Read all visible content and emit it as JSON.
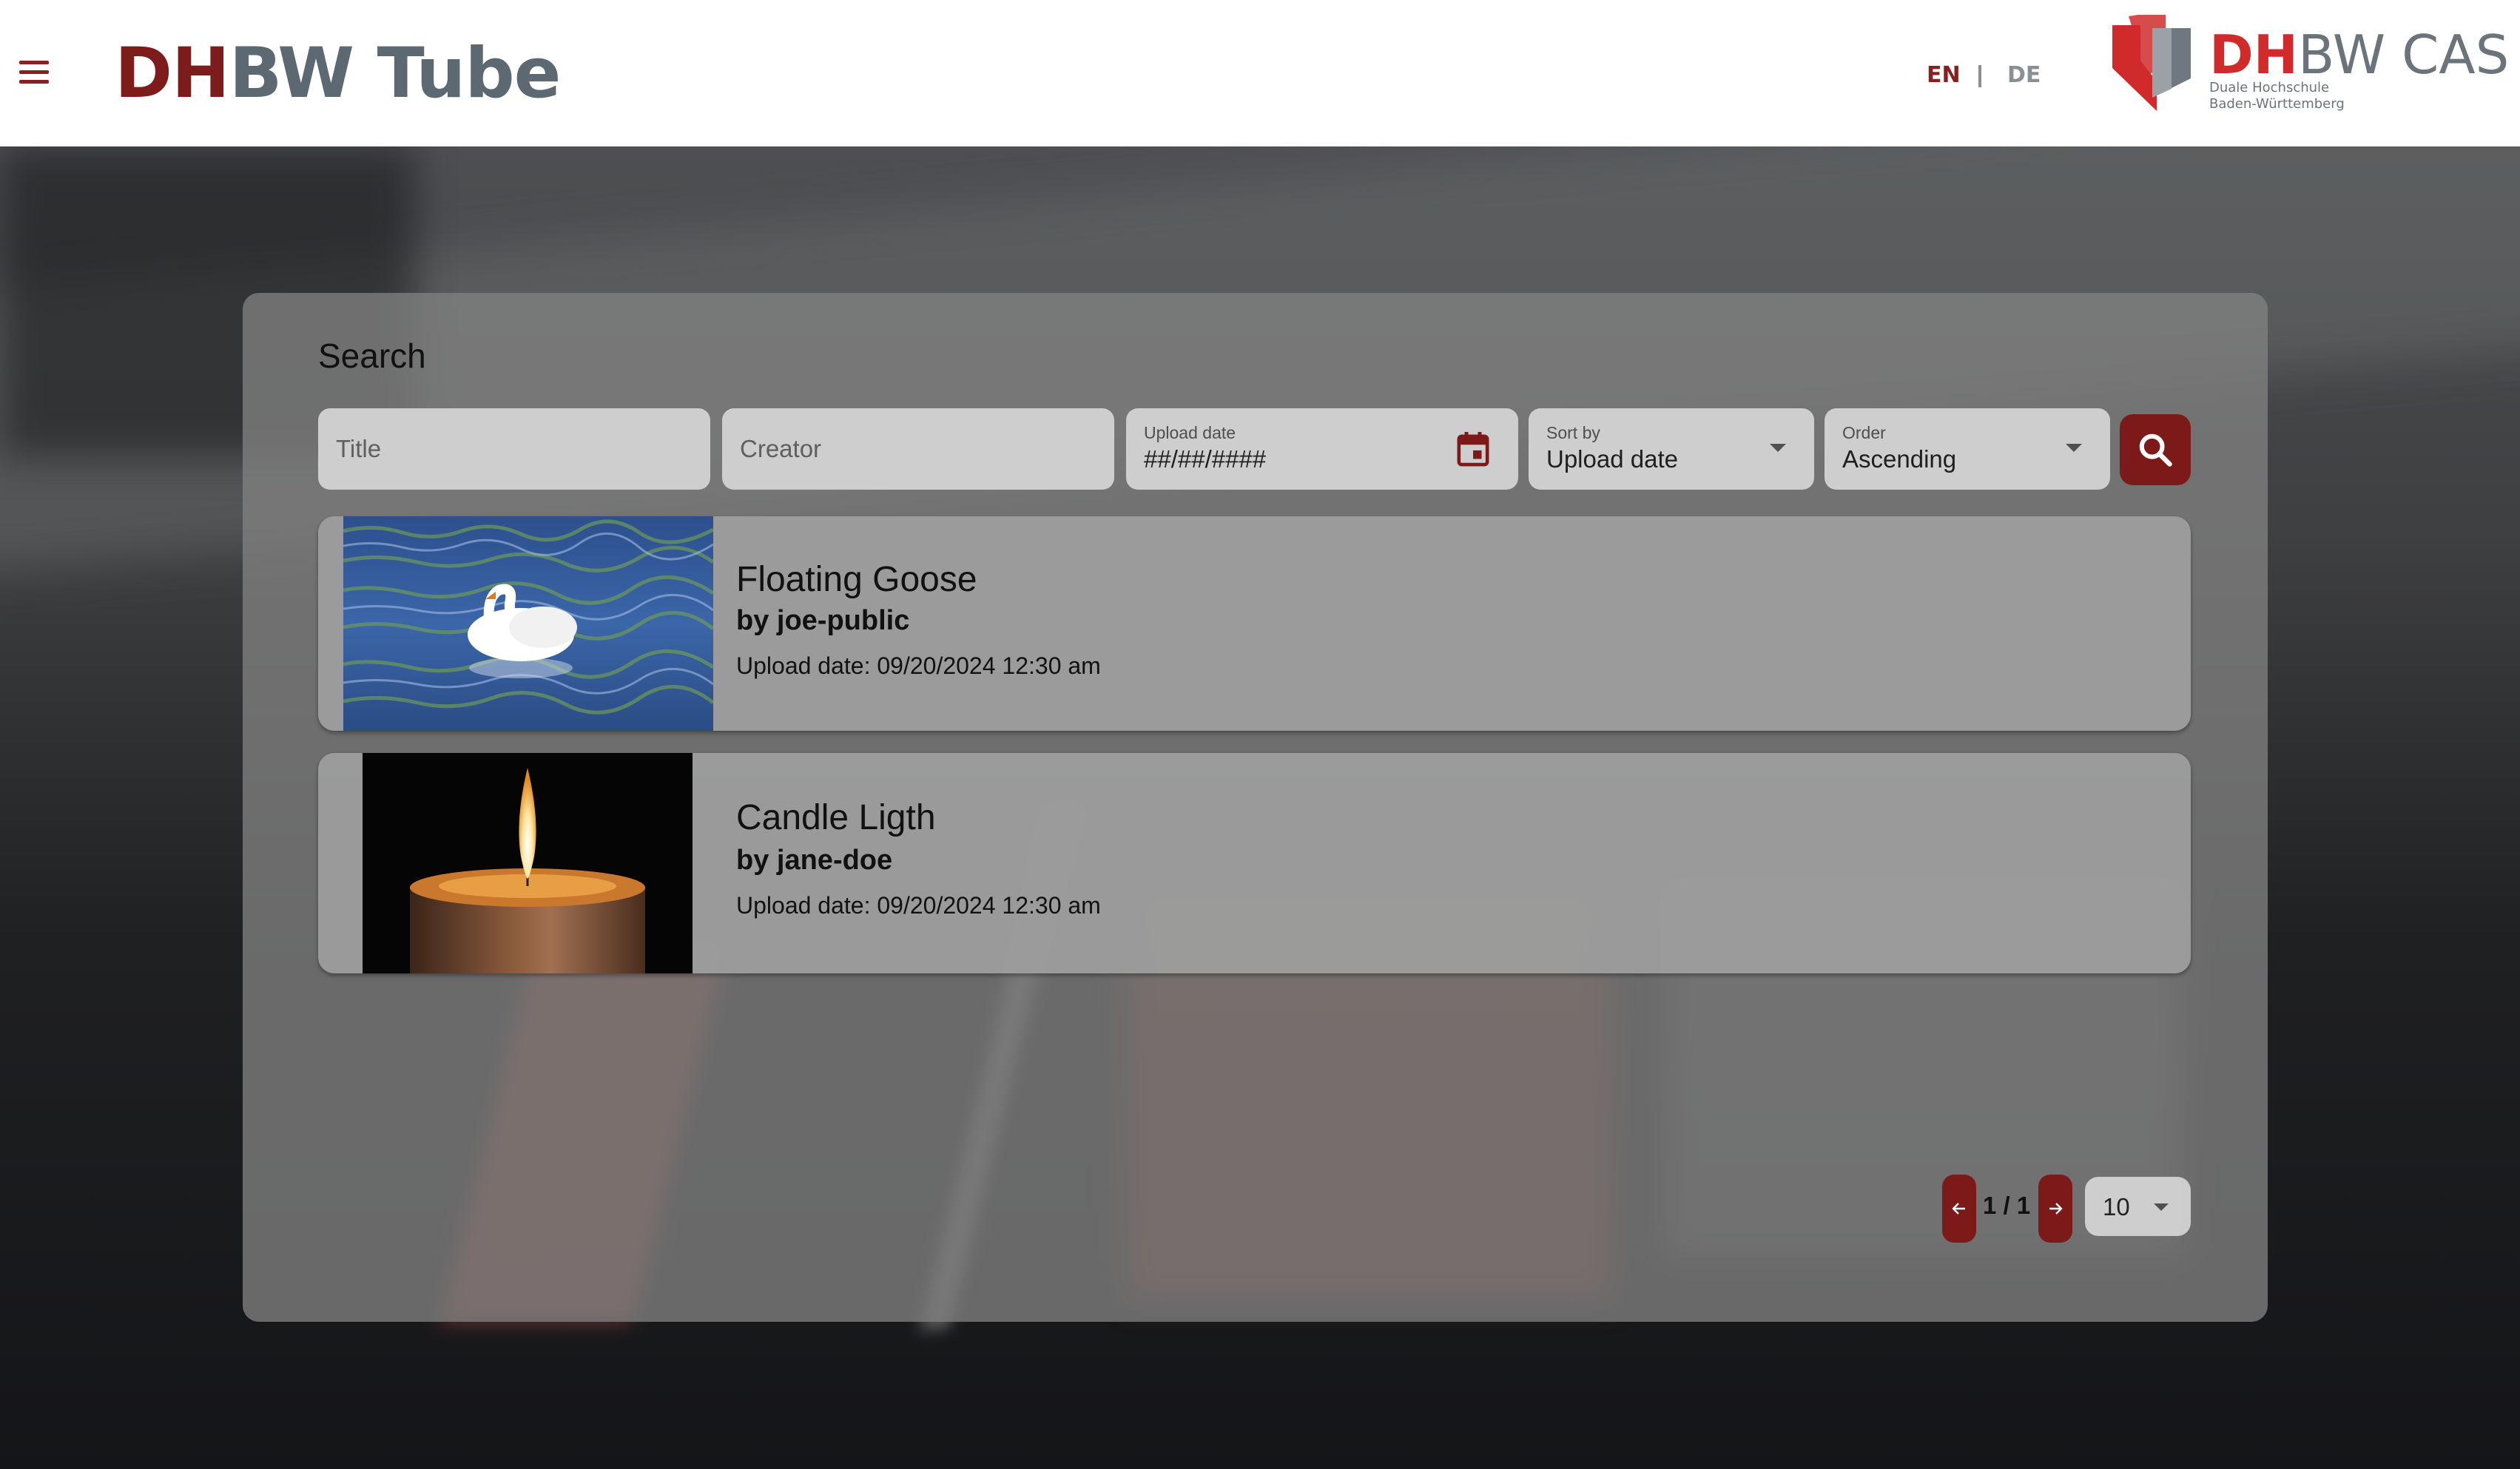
{
  "header": {
    "brand_part1": "DH",
    "brand_part2": "BW Tube",
    "lang_en": "EN",
    "lang_de": "DE",
    "logo_part1": "DH",
    "logo_part2": "BW",
    "logo_part3": "CAS",
    "logo_sub1": "Duale Hochschule",
    "logo_sub2": "Baden-Württemberg"
  },
  "search": {
    "heading": "Search",
    "title_placeholder": "Title",
    "creator_placeholder": "Creator",
    "upload_date_label": "Upload date",
    "upload_date_value": "##/##/####",
    "sort_label": "Sort by",
    "sort_value": "Upload date",
    "order_label": "Order",
    "order_value": "Ascending"
  },
  "results": [
    {
      "title": "Floating Goose",
      "creator": "by joe-public",
      "upload_date": "Upload date: 09/20/2024 12:30 am"
    },
    {
      "title": "Candle Ligth",
      "creator": "by jane-doe",
      "upload_date": "Upload date: 09/20/2024 12:30 am"
    }
  ],
  "pagination": {
    "page_text": "1 / 1",
    "page_size": "10"
  },
  "colors": {
    "brand_red": "#7c1a1a",
    "brand_grey": "#5d6972",
    "logo_red": "#d12a2a"
  }
}
